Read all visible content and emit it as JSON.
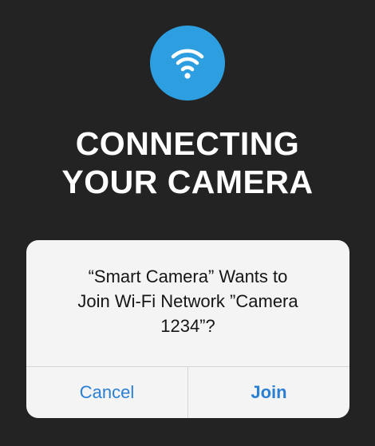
{
  "screen": {
    "background_color": "#232323"
  },
  "status_icon": {
    "icon": "wifi-icon",
    "color": "#2d9ee0"
  },
  "heading": {
    "line1": "CONNECTING",
    "line2": "YOUR CAMERA"
  },
  "dialog": {
    "message_line1": "“Smart Camera” Wants to",
    "message_line2": "Join Wi-Fi Network ”Camera",
    "message_line3": "1234”?",
    "cancel_label": "Cancel",
    "join_label": "Join",
    "button_color": "#2a7fd3"
  }
}
